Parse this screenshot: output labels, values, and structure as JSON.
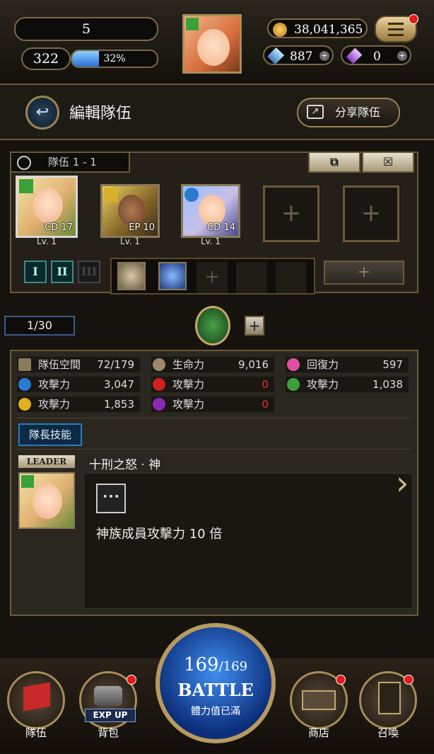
{
  "topbar": {
    "level": "5",
    "stamina": "322",
    "exp_percent": 32,
    "exp_label": "32%",
    "gold": "38,041,365",
    "diamonds": "887",
    "soul_stones": "0"
  },
  "header": {
    "title": "編輯隊伍",
    "share_label": "分享隊伍"
  },
  "team": {
    "tab_label": "隊伍 1 - 1",
    "members": [
      {
        "overlay": "CD 17",
        "level": "Lv. 1",
        "attribute": "wood"
      },
      {
        "overlay": "EP 10",
        "level": "Lv. 1",
        "attribute": "light"
      },
      {
        "overlay": "CD 14",
        "level": "Lv. 1",
        "attribute": "water"
      }
    ],
    "empty_plus": "+",
    "set_buttons": [
      "I",
      "II",
      "III"
    ],
    "bag_plus": "+"
  },
  "pagination": {
    "current": "1/30",
    "plus": "+"
  },
  "stats": {
    "rows": [
      [
        {
          "label": "隊伍空間",
          "value": "72/179",
          "icon": "flag-icon"
        },
        {
          "label": "生命力",
          "value": "9,016",
          "icon": "drop-icon"
        },
        {
          "label": "回復力",
          "value": "597",
          "icon": "heart-icon"
        }
      ],
      [
        {
          "label": "攻擊力",
          "value": "3,047",
          "icon": "water-icon"
        },
        {
          "label": "攻擊力",
          "value": "0",
          "icon": "fire-icon"
        },
        {
          "label": "攻擊力",
          "value": "1,038",
          "icon": "wood-icon"
        }
      ],
      [
        {
          "label": "攻擊力",
          "value": "1,853",
          "icon": "light-icon"
        },
        {
          "label": "攻擊力",
          "value": "0",
          "icon": "dark-icon"
        }
      ]
    ],
    "leader_skill_tab": "隊長技能",
    "leader_badge": "LEADER",
    "skill_name": "十刑之怒 · 神",
    "skill_icon_text": "•••",
    "skill_desc": "神族成員攻擊力 10 倍"
  },
  "bottom": {
    "nav": [
      {
        "label": "隊伍",
        "name": "nav-team"
      },
      {
        "label": "背包",
        "name": "nav-bag"
      },
      {
        "label": "商店",
        "name": "nav-shop"
      },
      {
        "label": "召喚",
        "name": "nav-summon"
      }
    ],
    "exp_up": "EXP UP",
    "battle": {
      "stamina_current": "169",
      "stamina_max": "/169",
      "label": "BATTLE",
      "status": "體力值已滿"
    }
  }
}
